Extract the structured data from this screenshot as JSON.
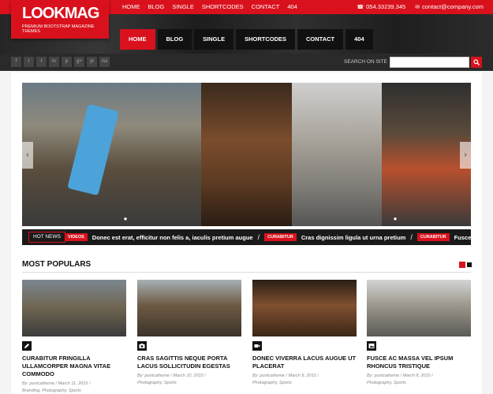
{
  "topnav": [
    "HOME",
    "BLOG",
    "SINGLE",
    "SHORTCODES",
    "CONTACT",
    "404"
  ],
  "contact": {
    "phone": "054.33239.345",
    "email": "contact@company.com"
  },
  "logo": {
    "title": "LOOKMAG",
    "subtitle": "PREMIUM BOOTSTRAP MAGAZINE THEMES"
  },
  "mainnav": [
    "HOME",
    "BLOG",
    "SINGLE",
    "SHORTCODES",
    "CONTACT",
    "404"
  ],
  "socials": [
    "f",
    "t",
    "t",
    "in",
    "p",
    "g+",
    "yt",
    "rss"
  ],
  "search": {
    "label": "SEARCH ON SITE",
    "placeholder": ""
  },
  "ticker": {
    "label": "HOT NEWS",
    "items": [
      {
        "tag": "VIDEOS",
        "text": "Donec est erat, efficitur non felis a, iaculis pretium augue"
      },
      {
        "tag": "CURABITUR",
        "text": "Cras dignissim ligula ut urna pretium"
      },
      {
        "tag": "CURABITUR",
        "text": "Fusce purus ex,"
      }
    ]
  },
  "section": {
    "title": "MOST POPULARS"
  },
  "cards": [
    {
      "title": "CURABITUR FRINGILLA ULLAMCORPER MAGNA VITAE COMMODO",
      "meta": "By: punicatheme / March 11, 2015 /",
      "cats": "Branding, Photography, Sports",
      "format": "pencil-icon"
    },
    {
      "title": "CRAS SAGITTIS NEQUE PORTA LACUS SOLLICITUDIN EGESTAS",
      "meta": "By: punicatheme / March 10, 2015 /",
      "cats": "Photography, Sports",
      "format": "camera-icon"
    },
    {
      "title": "DONEC VIVERRA LACUS AUGUE UT PLACERAT",
      "meta": "By: punicatheme / March 9, 2015 /",
      "cats": "Photography, Sports",
      "format": "video-icon"
    },
    {
      "title": "FUSCE AC MASSA VEL IPSUM RHONCUS TRISTIQUE",
      "meta": "By: punicatheme / March 8, 2015 /",
      "cats": "Photography, Sports",
      "format": "image-icon"
    }
  ],
  "colors": {
    "accent": "#d9111d",
    "dark": "#1a1a1a"
  }
}
